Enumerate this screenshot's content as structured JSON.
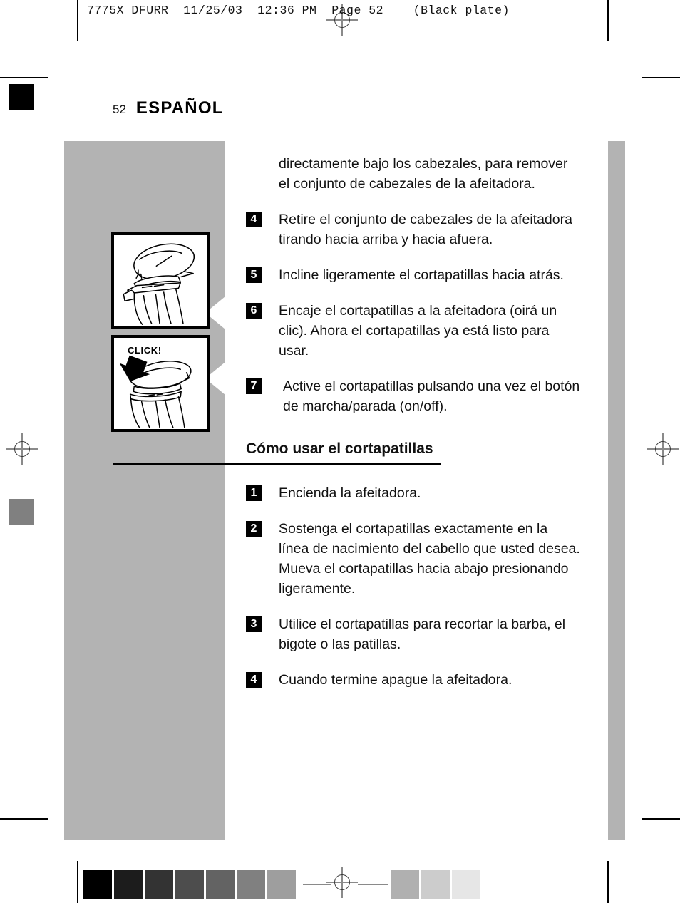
{
  "prepress": {
    "slug": "7775X DFURR  11/25/03  12:36 PM  Page 52    (Black plate)",
    "color_bar_label": "grayscale-step-wedge",
    "dark_swatches": [
      "#000000",
      "#1c1c1c",
      "#333333",
      "#4d4d4d",
      "#636363",
      "#808080",
      "#9e9e9e"
    ],
    "light_swatches": [
      "#b0b0b0",
      "#cccccc",
      "#e6e6e6"
    ],
    "margin_swatches": [
      "#000000",
      "#808080"
    ]
  },
  "page": {
    "folio": "52",
    "chapter": "ESPAÑOL",
    "band_color": "#b3b3b3"
  },
  "figures": [
    {
      "name": "shaver-head-removal",
      "caption": ""
    },
    {
      "name": "trimmer-click-attach",
      "caption": "CLICK!"
    }
  ],
  "content": {
    "intro_paragraph": "directamente bajo los cabezales, para remover el conjunto de cabezales de la afeitadora.",
    "continued_steps": [
      {
        "num": "4",
        "text": "Retire el conjunto de cabezales de la afeitadora tirando hacia arriba y hacia afuera."
      },
      {
        "num": "5",
        "text": "Incline ligeramente el cortapatillas hacia atrás."
      },
      {
        "num": "6",
        "text": "Encaje el cortapatillas a la afeitadora (oirá un clic). Ahora el cortapatillas ya está listo para usar."
      },
      {
        "num": "7",
        "text": "Active el cortapatillas pulsando una vez el botón de marcha/parada (on/off)."
      }
    ],
    "section_heading": "Cómo usar el cortapatillas",
    "usage_steps": [
      {
        "num": "1",
        "text": "Encienda la afeitadora."
      },
      {
        "num": "2",
        "text": "Sostenga el cortapatillas exactamente en la línea de nacimiento del cabello que usted desea. Mueva el cortapatillas hacia abajo presionando ligeramente."
      },
      {
        "num": "3",
        "text": "Utilice el cortapatillas para recortar la barba, el bigote o las patillas."
      },
      {
        "num": "4",
        "text": "Cuando termine apague la afeitadora."
      }
    ]
  }
}
